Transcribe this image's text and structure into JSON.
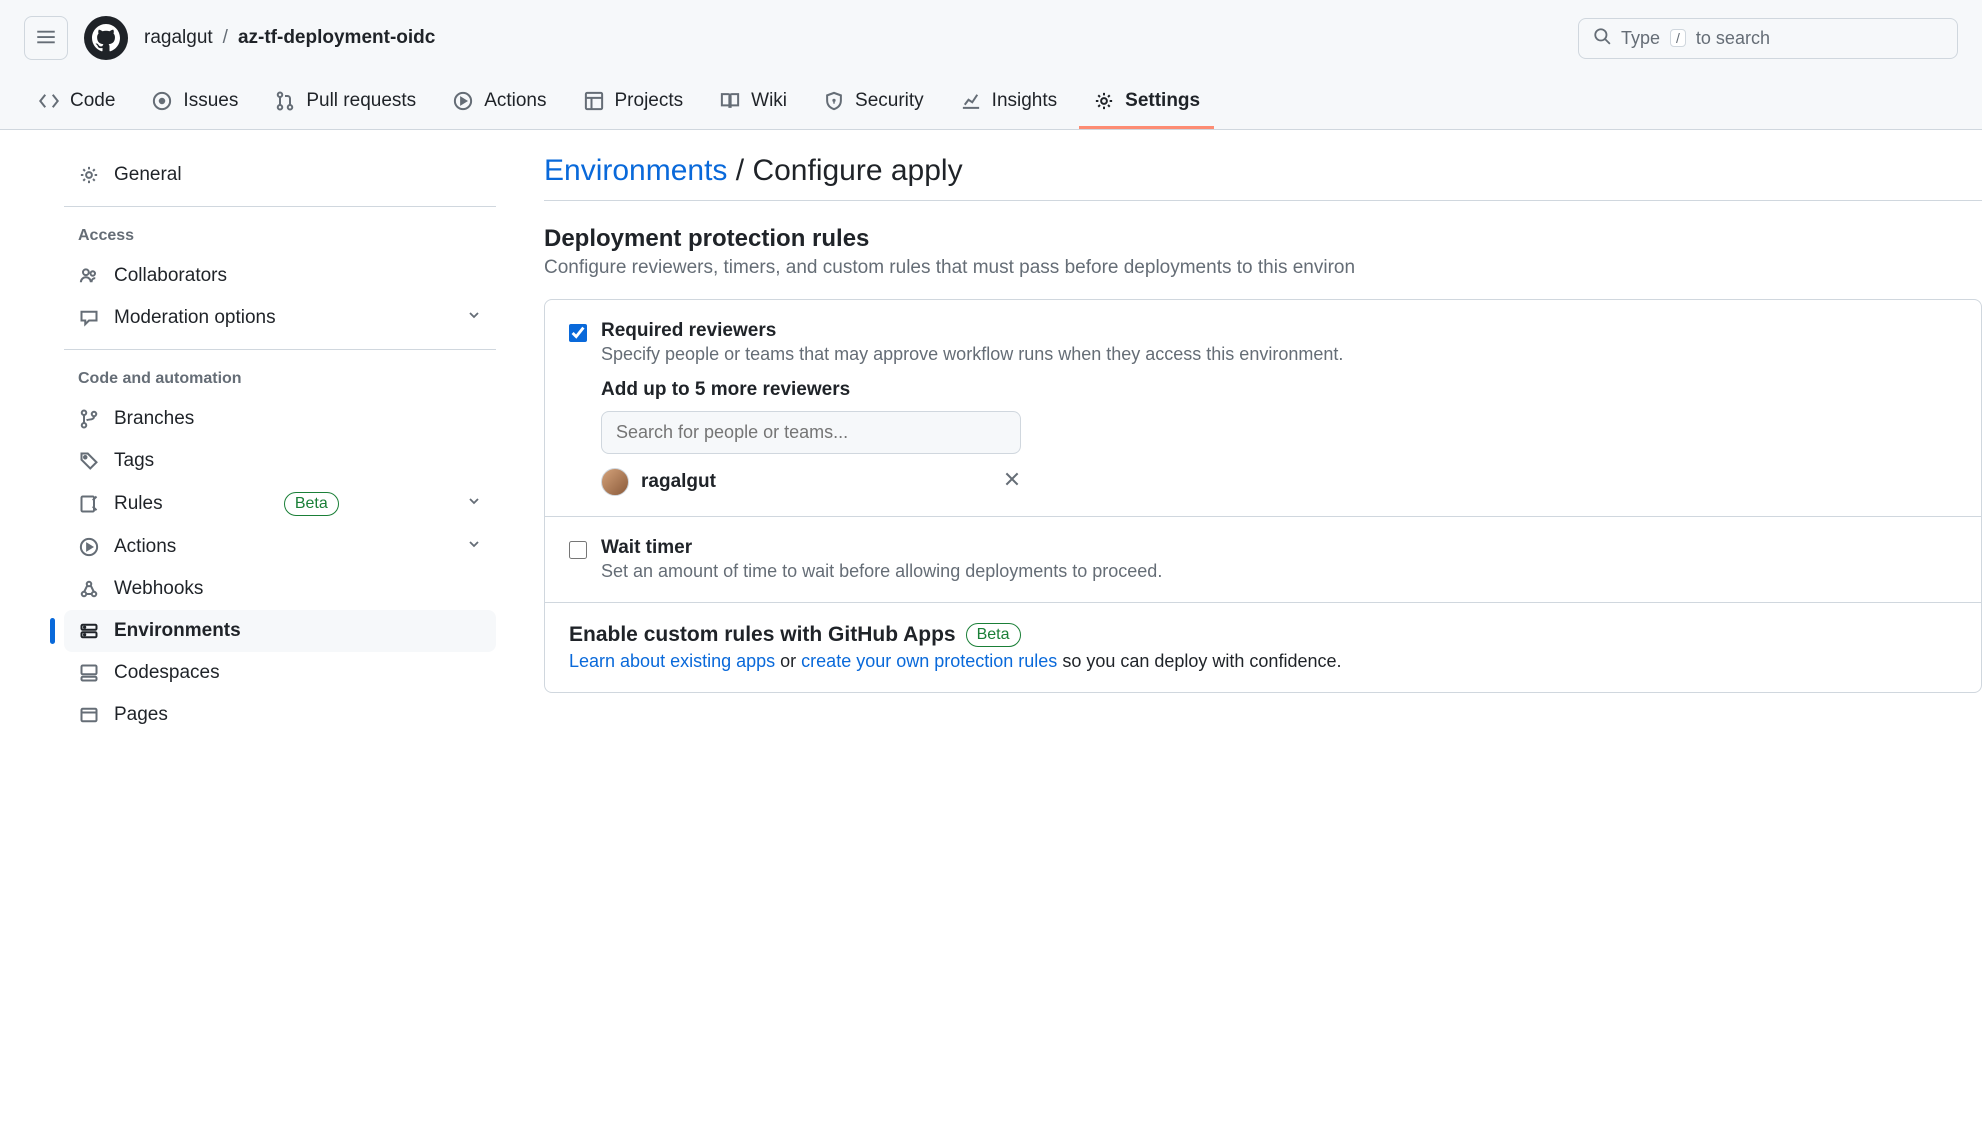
{
  "header": {
    "owner": "ragalgut",
    "separator": "/",
    "repo": "az-tf-deployment-oidc",
    "search_prefix": "Type",
    "search_kbd": "/",
    "search_suffix": "to search"
  },
  "tabs": {
    "code": "Code",
    "issues": "Issues",
    "pulls": "Pull requests",
    "actions": "Actions",
    "projects": "Projects",
    "wiki": "Wiki",
    "security": "Security",
    "insights": "Insights",
    "settings": "Settings"
  },
  "sidebar": {
    "general": "General",
    "section_access": "Access",
    "collaborators": "Collaborators",
    "moderation": "Moderation options",
    "section_code": "Code and automation",
    "branches": "Branches",
    "tags": "Tags",
    "rules": "Rules",
    "rules_badge": "Beta",
    "actions": "Actions",
    "webhooks": "Webhooks",
    "environments": "Environments",
    "codespaces": "Codespaces",
    "pages": "Pages"
  },
  "content": {
    "title_link": "Environments",
    "title_sep": "/",
    "title_current": "Configure apply",
    "section_title": "Deployment protection rules",
    "section_desc": "Configure reviewers, timers, and custom rules that must pass before deployments to this environ",
    "required_reviewers_title": "Required reviewers",
    "required_reviewers_desc": "Specify people or teams that may approve workflow runs when they access this environment.",
    "add_reviewers_title": "Add up to 5 more reviewers",
    "search_placeholder": "Search for people or teams...",
    "reviewer_name": "ragalgut",
    "wait_timer_title": "Wait timer",
    "wait_timer_desc": "Set an amount of time to wait before allowing deployments to proceed.",
    "custom_rules_title": "Enable custom rules with GitHub Apps",
    "custom_rules_badge": "Beta",
    "custom_learn_link": "Learn about existing apps",
    "custom_or": " or ",
    "custom_create_link": "create your own protection rules",
    "custom_suffix": " so you can deploy with confidence."
  }
}
